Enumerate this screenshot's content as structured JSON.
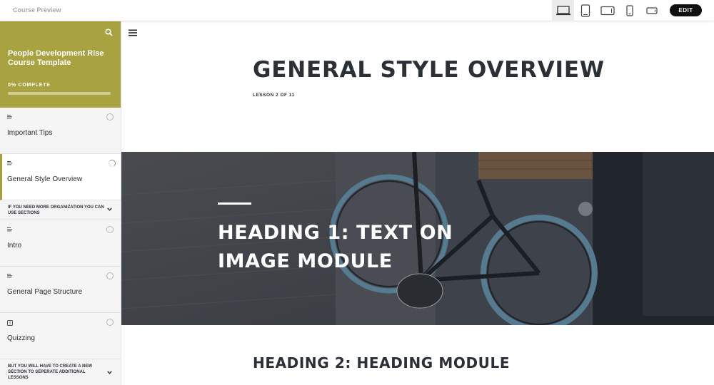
{
  "topbar": {
    "title": "Course Preview",
    "devices": [
      {
        "name": "desktop-icon",
        "active": true
      },
      {
        "name": "tablet-portrait-icon",
        "active": false
      },
      {
        "name": "tablet-landscape-icon",
        "active": false
      },
      {
        "name": "phone-portrait-icon",
        "active": false
      },
      {
        "name": "phone-landscape-icon",
        "active": false
      }
    ],
    "edit_label": "EDIT"
  },
  "sidebar": {
    "course_title": "People Development Rise Course Template",
    "progress_label": "0% COMPLETE",
    "progress": 0,
    "accent_color": "#a8a240",
    "items": [
      {
        "kind": "lesson",
        "type_icon": "text-lesson-icon",
        "label": "Important Tips",
        "status": "not-started"
      },
      {
        "kind": "lesson",
        "type_icon": "text-lesson-icon",
        "label": "General Style Overview",
        "status": "in-progress",
        "active": true
      },
      {
        "kind": "section",
        "label": "IF YOU NEED MORE ORGANIZATION YOU CAN USE SECTIONS"
      },
      {
        "kind": "lesson",
        "type_icon": "text-lesson-icon",
        "label": "Intro",
        "status": "not-started"
      },
      {
        "kind": "lesson",
        "type_icon": "text-lesson-icon",
        "label": "General Page Structure",
        "status": "not-started"
      },
      {
        "kind": "lesson",
        "type_icon": "quiz-icon",
        "label": "Quizzing",
        "status": "not-started"
      },
      {
        "kind": "section",
        "label": "BUT YOU WILL HAVE TO CREATE A NEW SECTION TO SEPERATE ADDITIONAL LESSONS"
      }
    ]
  },
  "main": {
    "lesson_title": "GENERAL STYLE OVERVIEW",
    "lesson_count": "LESSON 2 OF 11",
    "hero_heading": "Heading 1: Text on Image Module",
    "heading2": "Heading 2: Heading Module"
  }
}
